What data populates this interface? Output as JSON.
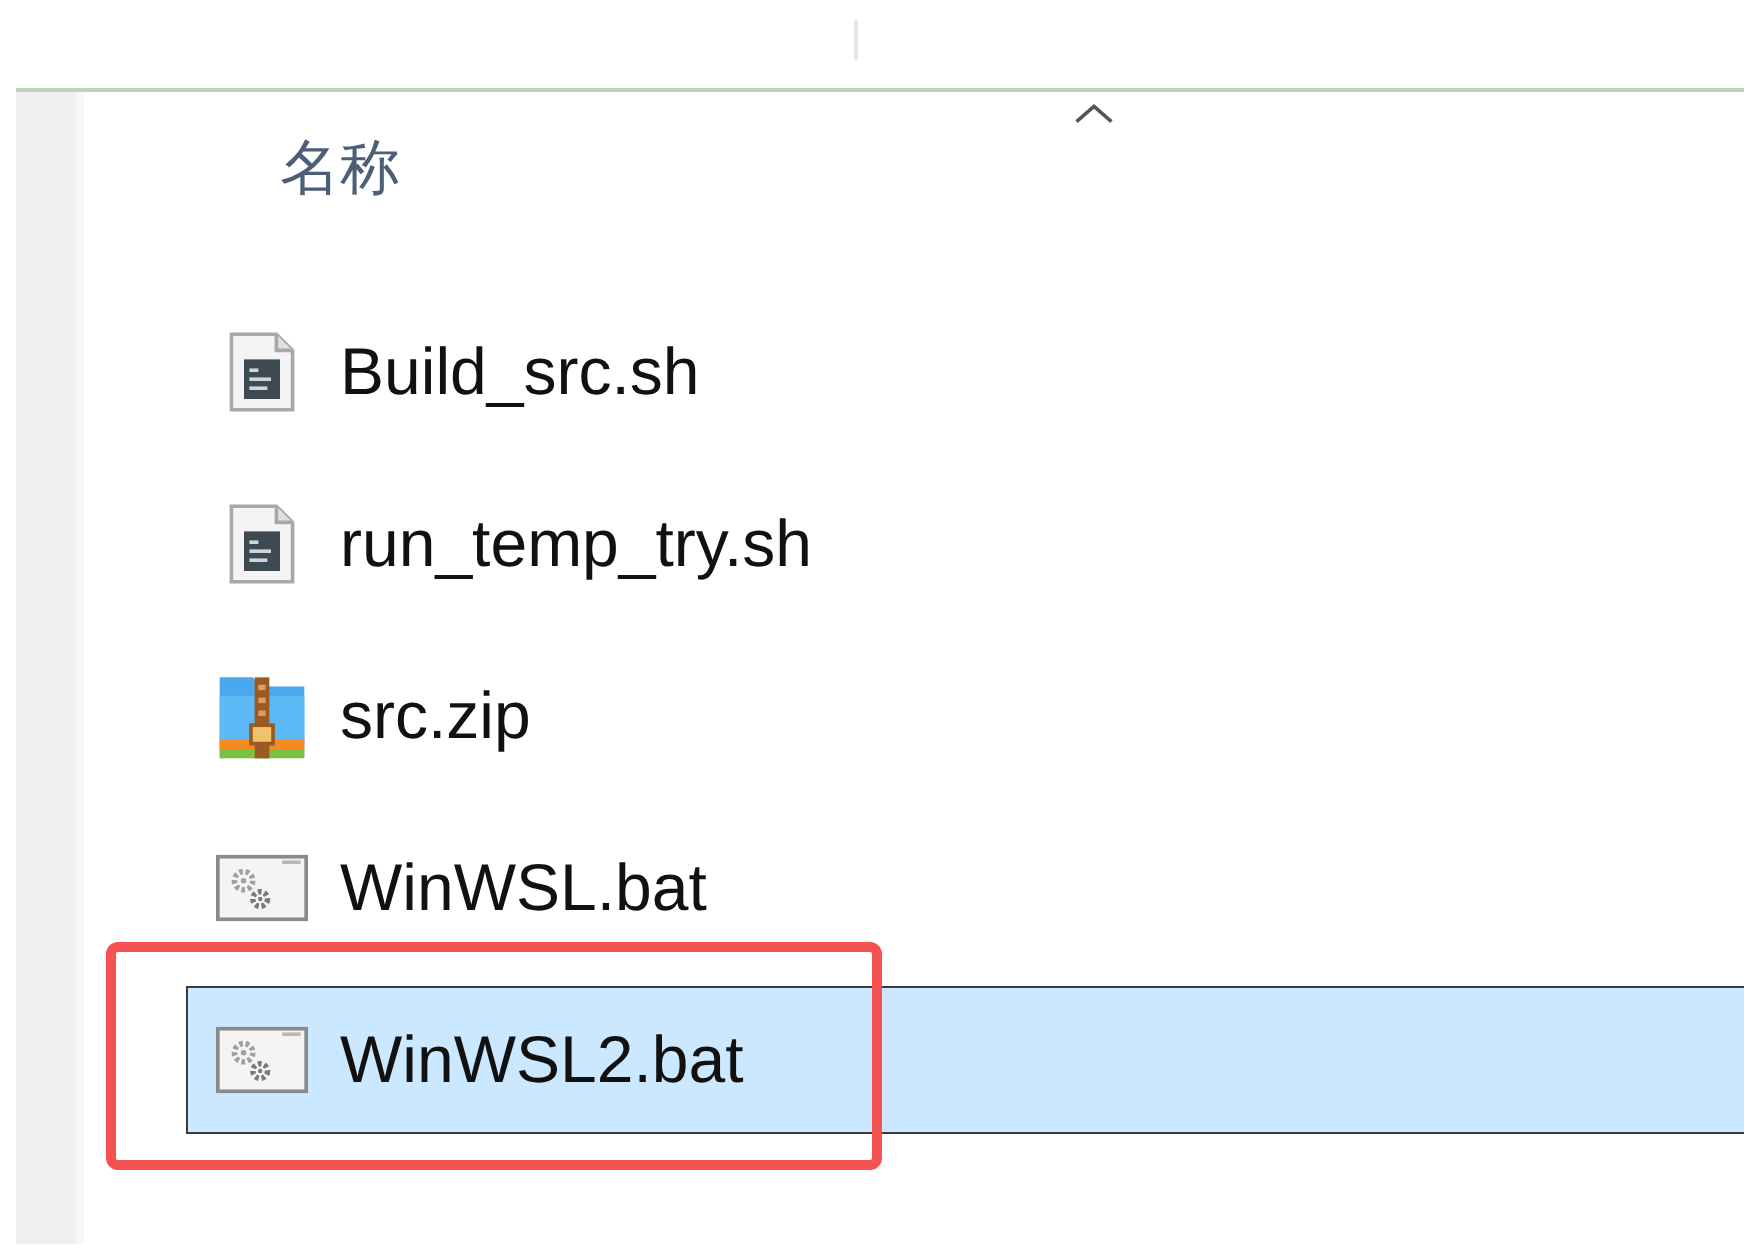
{
  "header": {
    "label": "名称",
    "sorted_ascending": true
  },
  "files": [
    {
      "name": "Build_src.sh",
      "kind": "script",
      "selected": false,
      "highlighted": false
    },
    {
      "name": "run_temp_try.sh",
      "kind": "script",
      "selected": false,
      "highlighted": false
    },
    {
      "name": "src.zip",
      "kind": "archive",
      "selected": false,
      "highlighted": false
    },
    {
      "name": "WinWSL.bat",
      "kind": "batch",
      "selected": false,
      "highlighted": false
    },
    {
      "name": "WinWSL2.bat",
      "kind": "batch",
      "selected": true,
      "highlighted": true
    }
  ]
}
